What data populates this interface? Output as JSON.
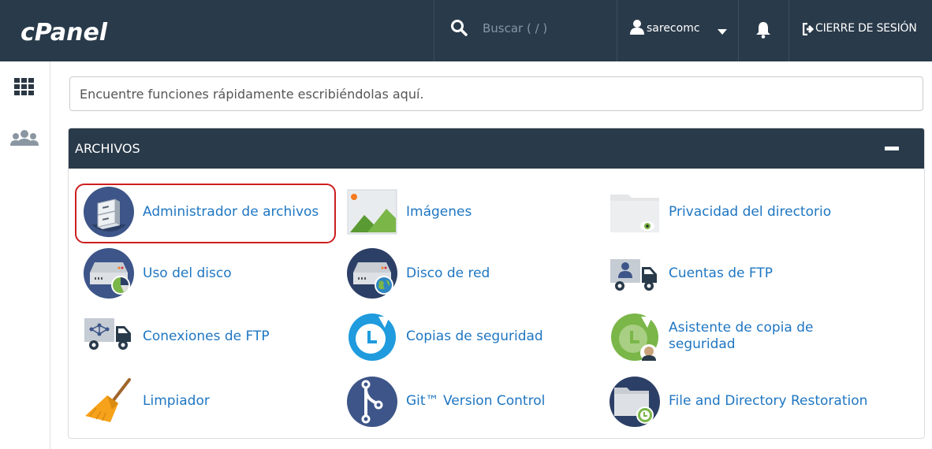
{
  "header": {
    "logo_text": "cPanel",
    "search_placeholder": "Buscar ( / )",
    "username": "sarecomc",
    "logout_label": "CIERRE DE SESIÓN"
  },
  "sidebar": {
    "items": [
      {
        "name": "apps-grid-icon"
      },
      {
        "name": "users-icon"
      }
    ]
  },
  "quick_search": {
    "placeholder": "Encuentre funciones rápidamente escribiéndolas aquí."
  },
  "section": {
    "title": "ARCHIVOS",
    "items": [
      {
        "label": "Administrador de archivos",
        "icon": "file-cabinet-icon",
        "highlighted": true
      },
      {
        "label": "Imágenes",
        "icon": "image-icon"
      },
      {
        "label": "Privacidad del directorio",
        "icon": "folder-eye-icon"
      },
      {
        "label": "Uso del disco",
        "icon": "disk-pie-icon"
      },
      {
        "label": "Disco de red",
        "icon": "network-disk-icon"
      },
      {
        "label": "Cuentas de FTP",
        "icon": "ftp-truck-user-icon"
      },
      {
        "label": "Conexiones de FTP",
        "icon": "ftp-truck-network-icon"
      },
      {
        "label": "Copias de seguridad",
        "icon": "backup-clock-icon"
      },
      {
        "label_line1": "Asistente de copia de",
        "label_line2": "seguridad",
        "icon": "backup-wizard-icon"
      },
      {
        "label": "Limpiador",
        "icon": "broom-icon"
      },
      {
        "label": "Git™ Version Control",
        "icon": "git-icon"
      },
      {
        "label": "File and Directory Restoration",
        "icon": "folder-restore-icon"
      }
    ]
  },
  "colors": {
    "topbar": "#293a4a",
    "link": "#1e76c2",
    "highlight": "#cc1f1f"
  }
}
